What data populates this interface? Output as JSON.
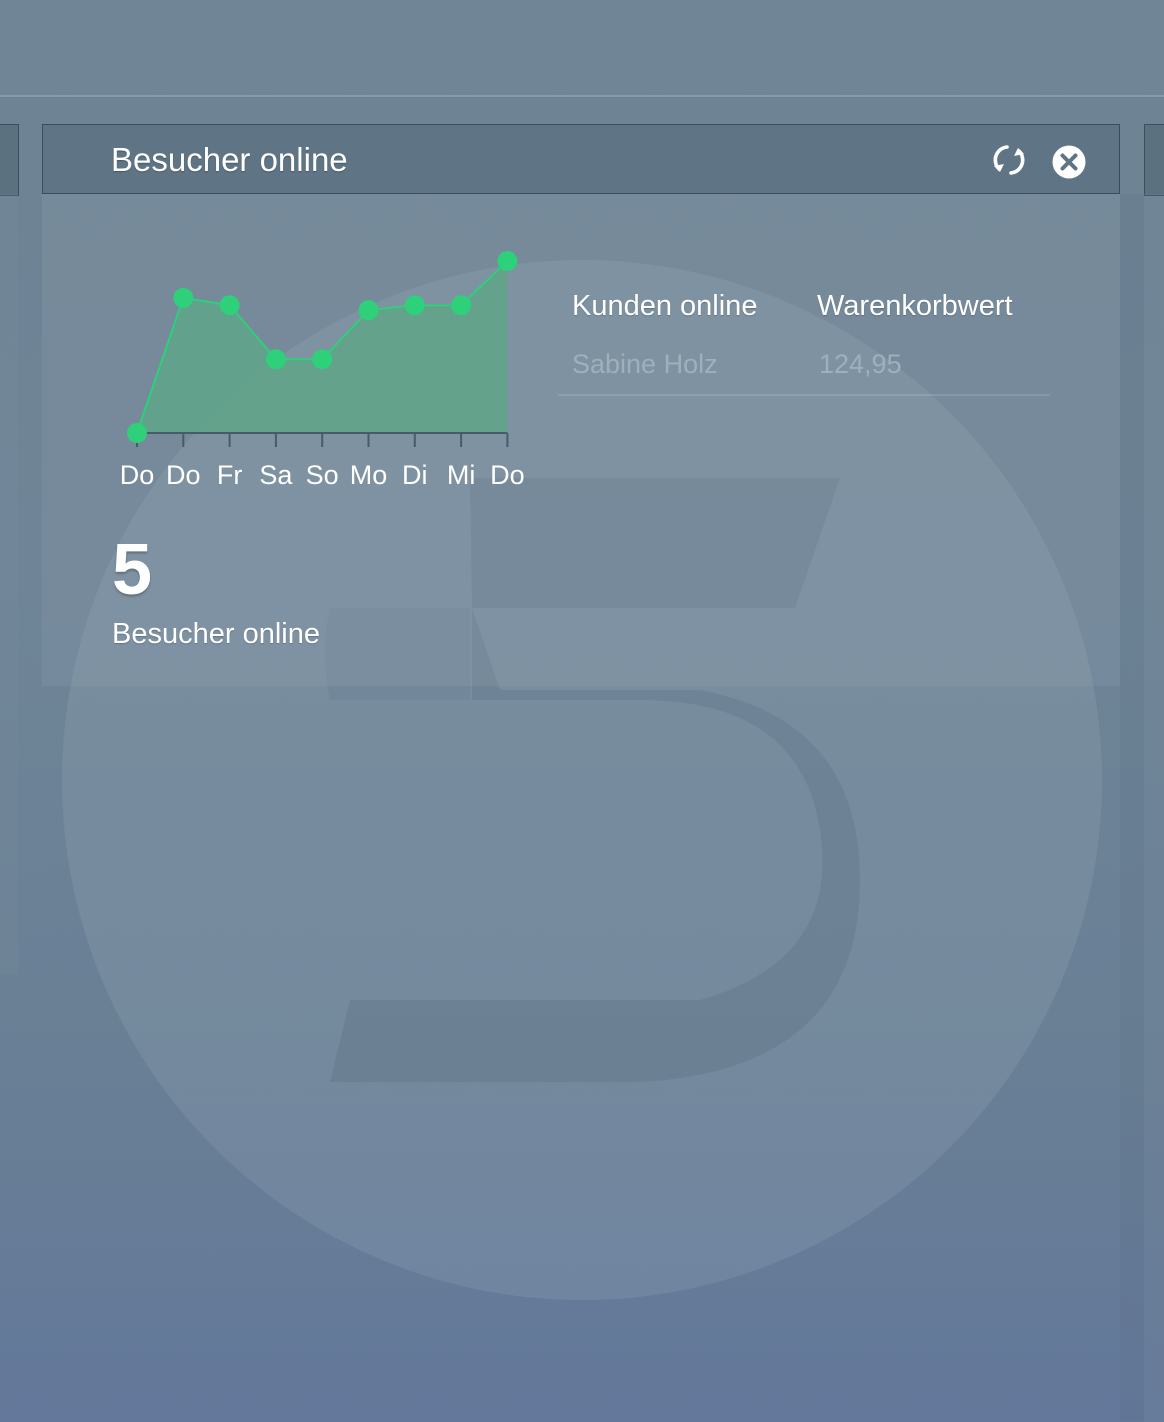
{
  "widget": {
    "title": "Besucher online",
    "refresh_icon": "refresh-icon",
    "close_icon": "close-circle-icon"
  },
  "chart_data": {
    "type": "area",
    "categories": [
      "Do",
      "Do",
      "Fr",
      "Sa",
      "So",
      "Mo",
      "Di",
      "Mi",
      "Do"
    ],
    "values": [
      0,
      5.5,
      5.2,
      3.0,
      3.0,
      5.0,
      5.2,
      5.2,
      7.0
    ],
    "ylim": [
      0,
      7
    ],
    "grid": false,
    "fill_color": "#5fa488",
    "point_color": "#2ed07a"
  },
  "customers_table": {
    "headers": [
      "Kunden online",
      "Warenkorbwert"
    ],
    "rows": [
      [
        "Sabine Holz",
        "124,95"
      ]
    ]
  },
  "summary": {
    "count": "5",
    "label": "Besucher online"
  },
  "colors": {
    "header_bg": "#5f7484",
    "muted_text": "#9fb0bc"
  }
}
